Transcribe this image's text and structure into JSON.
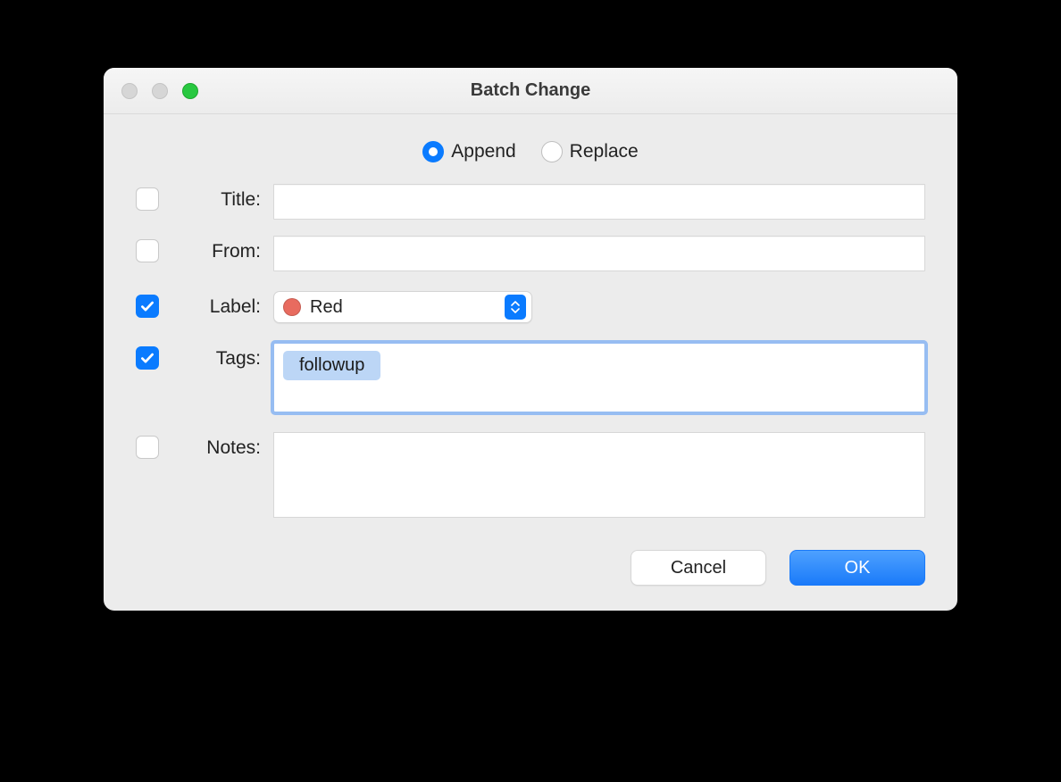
{
  "window": {
    "title": "Batch Change"
  },
  "mode": {
    "append": {
      "label": "Append",
      "selected": true
    },
    "replace": {
      "label": "Replace",
      "selected": false
    }
  },
  "fields": {
    "title": {
      "label": "Title:",
      "checked": false,
      "value": ""
    },
    "from": {
      "label": "From:",
      "checked": false,
      "value": ""
    },
    "label": {
      "label": "Label:",
      "checked": true,
      "selected": "Red",
      "color": "#e86b5f"
    },
    "tags": {
      "label": "Tags:",
      "checked": true,
      "items": [
        "followup"
      ]
    },
    "notes": {
      "label": "Notes:",
      "checked": false,
      "value": ""
    }
  },
  "buttons": {
    "cancel": "Cancel",
    "ok": "OK"
  }
}
